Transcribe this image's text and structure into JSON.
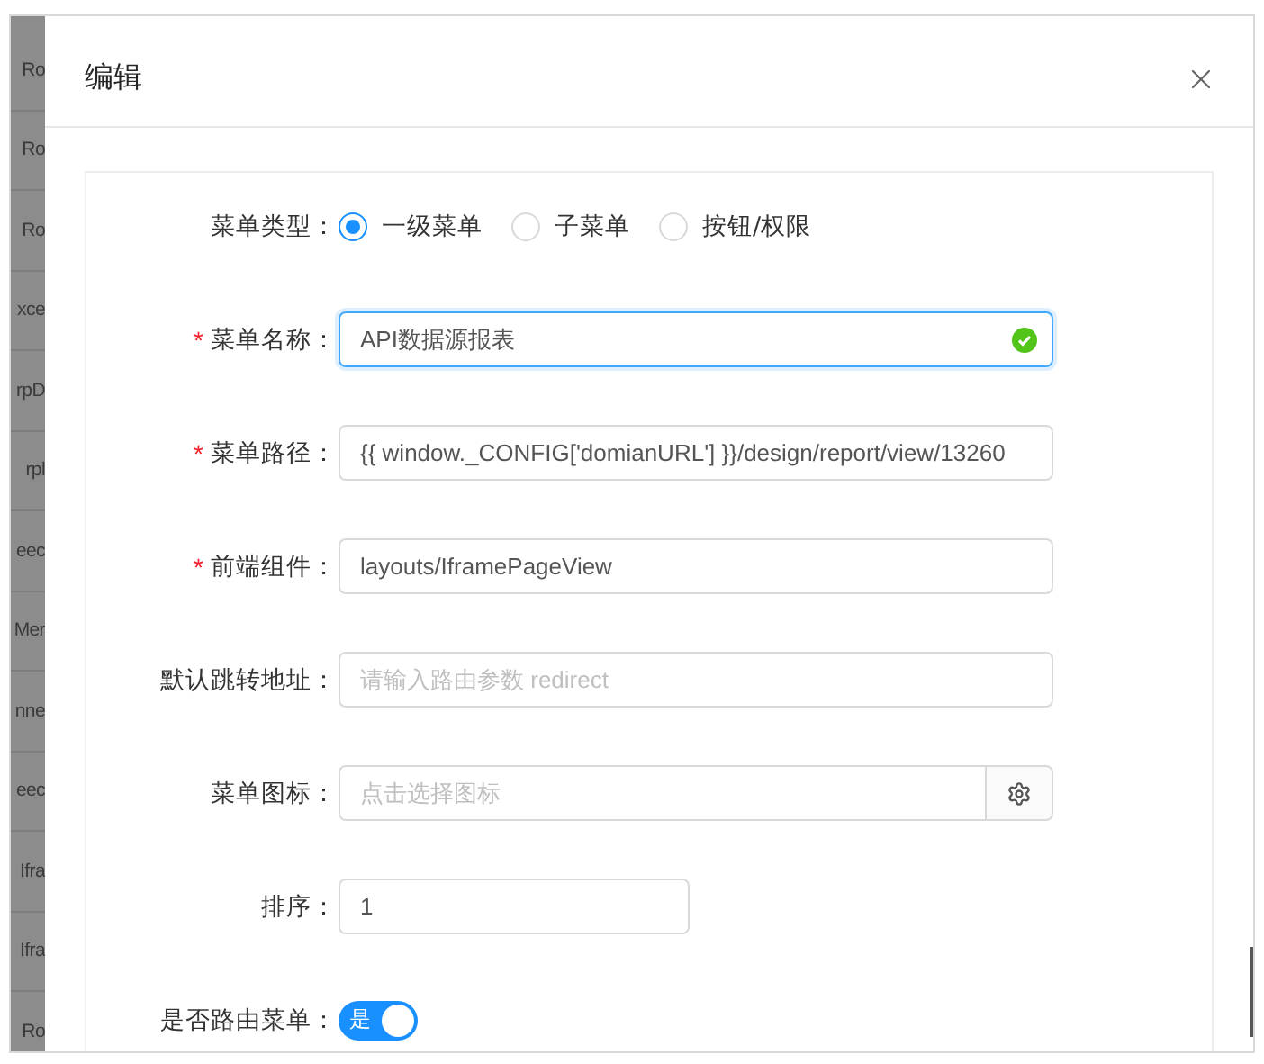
{
  "background_list": [
    "Ro",
    "Ro",
    "Ro",
    "xce",
    "rpD",
    "rpl",
    "eec",
    "Mer",
    "nne",
    "eec",
    "Ifra",
    "Ifra",
    "Ro"
  ],
  "dialog": {
    "title": "编辑",
    "fields": [
      {
        "kind": "radio",
        "label": "菜单类型：",
        "options": [
          {
            "label": "一级菜单",
            "selected": true
          },
          {
            "label": "子菜单",
            "selected": false
          },
          {
            "label": "按钮/权限",
            "selected": false
          }
        ]
      },
      {
        "kind": "input",
        "label": "菜单名称：",
        "required_mark": "*",
        "value": "API数据源报表",
        "valid": true,
        "focused": true
      },
      {
        "kind": "input",
        "label": "菜单路径：",
        "required_mark": "*",
        "value": "{{ window._CONFIG['domianURL'] }}/design/report/view/13260"
      },
      {
        "kind": "input",
        "label": "前端组件：",
        "required_mark": "*",
        "value": "layouts/IframePageView"
      },
      {
        "kind": "input",
        "label": "默认跳转地址：",
        "placeholder": "请输入路由参数 redirect"
      },
      {
        "kind": "icon_picker",
        "label": "菜单图标：",
        "placeholder": "点击选择图标"
      },
      {
        "kind": "number",
        "label": "排序：",
        "value": "1"
      },
      {
        "kind": "switch",
        "label": "是否路由菜单：",
        "on": true,
        "text": "是"
      }
    ]
  }
}
